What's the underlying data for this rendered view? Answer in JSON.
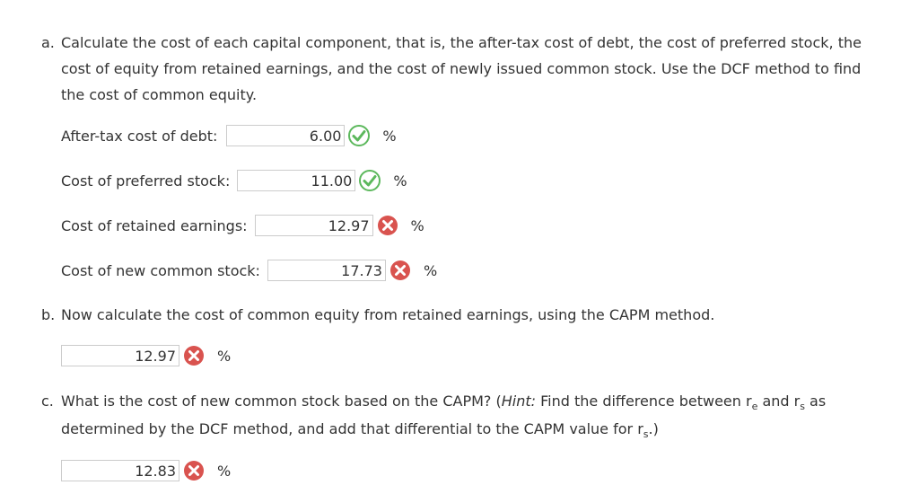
{
  "part_a": {
    "label": "a.",
    "text_line1": "Calculate the cost of each capital component, that is, the after-tax cost of debt, the cost of preferred stock, the",
    "text_line2": "cost of equity from retained earnings, and the cost of newly issued common stock. Use the DCF method to find",
    "text_line3": "the cost of common equity.",
    "rows": [
      {
        "label": "After-tax cost of debt:",
        "value": "6.00",
        "status": "correct",
        "unit": "%"
      },
      {
        "label": "Cost of preferred stock:",
        "value": "11.00",
        "status": "correct",
        "unit": "%"
      },
      {
        "label": "Cost of retained earnings:",
        "value": "12.97",
        "status": "incorrect",
        "unit": "%"
      },
      {
        "label": "Cost of new common stock:",
        "value": "17.73",
        "status": "incorrect",
        "unit": "%"
      }
    ]
  },
  "part_b": {
    "label": "b.",
    "text": "Now calculate the cost of common equity from retained earnings, using the CAPM method.",
    "answer": {
      "value": "12.97",
      "status": "incorrect",
      "unit": "%"
    }
  },
  "part_c": {
    "label": "c.",
    "text_a": "What is the cost of new common stock based on the CAPM? (",
    "hint_label": "Hint:",
    "text_b": " Find the difference between r",
    "sub_e": "e",
    "text_c": " and r",
    "sub_s": "s",
    "text_d": " as",
    "line2_a": "determined by the DCF method, and add that differential to the CAPM value for r",
    "line2_sub": "s",
    "line2_b": ".)",
    "answer": {
      "value": "12.83",
      "status": "incorrect",
      "unit": "%"
    }
  },
  "colors": {
    "correct": "#5cb85c",
    "incorrect": "#d9534f",
    "text": "#333333",
    "border": "#cccccc"
  }
}
